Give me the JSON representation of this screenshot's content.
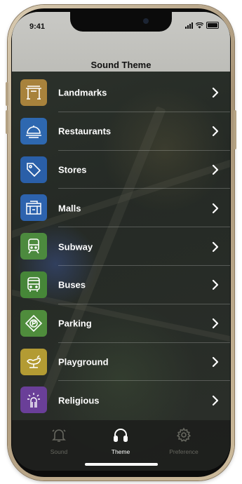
{
  "status_bar": {
    "time": "9:41"
  },
  "header": {
    "title": "Sound Theme"
  },
  "theme_items": [
    {
      "label": "Landmarks",
      "icon": "landmark-gate-icon",
      "color": "#a8823c"
    },
    {
      "label": "Restaurants",
      "icon": "food-cloche-icon",
      "color": "#2e68b0"
    },
    {
      "label": "Stores",
      "icon": "price-tag-icon",
      "color": "#2a5fa8"
    },
    {
      "label": "Malls",
      "icon": "mall-building-icon",
      "color": "#2d63ae"
    },
    {
      "label": "Subway",
      "icon": "subway-train-icon",
      "color": "#4c8a3e"
    },
    {
      "label": "Buses",
      "icon": "bus-icon",
      "color": "#468638"
    },
    {
      "label": "Parking",
      "icon": "parking-sign-icon",
      "color": "#4f8c3c"
    },
    {
      "label": "Playground",
      "icon": "playground-icon",
      "color": "#b39b33"
    },
    {
      "label": "Religious",
      "icon": "religious-icon",
      "color": "#6a3f98"
    }
  ],
  "tab_bar": {
    "tabs": [
      {
        "label": "Sound",
        "icon": "bell-icon",
        "active": false
      },
      {
        "label": "Theme",
        "icon": "headphones-icon",
        "active": true
      },
      {
        "label": "Preference",
        "icon": "gear-icon",
        "active": false
      }
    ]
  },
  "colors": {
    "active_tab": "#ffffff",
    "inactive_tab": "#66675f",
    "header_bg": "#c4c4c0"
  }
}
